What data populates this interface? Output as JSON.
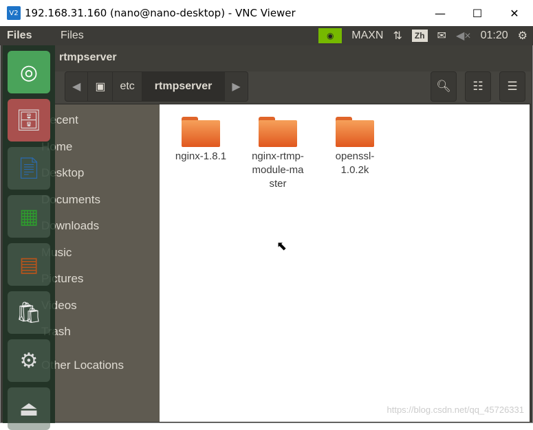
{
  "window": {
    "title": "192.168.31.160 (nano@nano-desktop) - VNC Viewer",
    "logo": "V2",
    "minimize": "—",
    "maximize": "☐",
    "close": "✕"
  },
  "panel": {
    "app_name": "Files",
    "menu": "Files",
    "nvidia": "MAXN",
    "lang": "Zh",
    "clock": "01:20",
    "icons": [
      "nvidia-icon",
      "network-icon",
      "mail-icon",
      "volume-muted-icon",
      "power-gear-icon"
    ]
  },
  "header": {
    "title": "rtmpserver"
  },
  "path": {
    "segments": [
      "etc",
      "rtmpserver"
    ]
  },
  "sidebar": {
    "items": [
      "Recent",
      "Home",
      "Desktop",
      "Documents",
      "Downloads",
      "Music",
      "Pictures",
      "Videos",
      "Trash",
      "Other Locations"
    ]
  },
  "files": [
    {
      "name": "nginx-1.8.1"
    },
    {
      "name": "nginx-rtmp-module-master"
    },
    {
      "name": "openssl-1.0.2k"
    }
  ],
  "watermark": "https://blog.csdn.net/qq_45726331"
}
